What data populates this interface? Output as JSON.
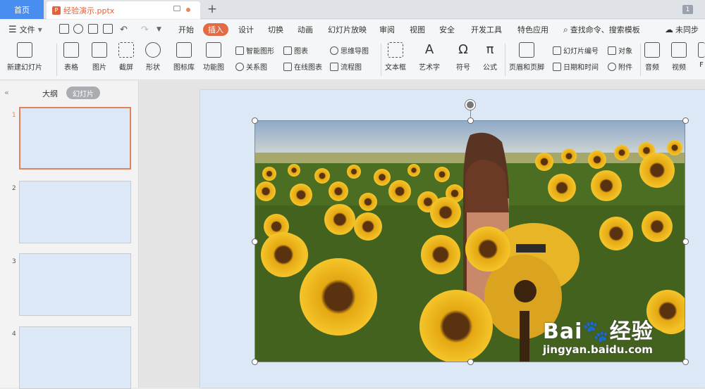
{
  "tabs": {
    "home": "首页",
    "doc_name": "经验演示.pptx",
    "doc_icon": "P",
    "new_tab": "+",
    "page_badge": "1"
  },
  "menu": {
    "file": "文件",
    "items": [
      "开始",
      "插入",
      "设计",
      "切换",
      "动画",
      "幻灯片放映",
      "审阅",
      "视图",
      "安全",
      "开发工具",
      "特色应用"
    ],
    "search": "查找命令、搜索模板",
    "sync": "未同步",
    "active": "插入"
  },
  "ribbon": {
    "new_slide": "新建幻灯片",
    "table": "表格",
    "picture": "图片",
    "screenshot": "截屏",
    "shape": "形状",
    "icon_lib": "图标库",
    "func_chart": "功能图",
    "smart_shape": "智能图形",
    "chart": "图表",
    "relation": "关系图",
    "online_chart": "在线图表",
    "mindmap": "思维导图",
    "flowchart": "流程图",
    "textbox": "文本框",
    "wordart": "艺术字",
    "symbol": "符号",
    "formula": "公式",
    "header_footer": "页眉和页脚",
    "slide_number": "幻灯片编号",
    "datetime": "日期和时间",
    "object": "对象",
    "attachment": "附件",
    "audio": "音频",
    "video": "视频",
    "flash": "F"
  },
  "panel": {
    "collapse": "«",
    "outline": "大纲",
    "slides": "幻灯片",
    "slide_numbers": [
      "1",
      "2",
      "3",
      "4"
    ]
  },
  "watermark": {
    "main": "Bai🐾经验",
    "sub": "jingyan.baidu.com"
  },
  "colors": {
    "accent": "#e26a44",
    "home_tab": "#4a8df0",
    "slide_bg": "#dce8f5"
  }
}
